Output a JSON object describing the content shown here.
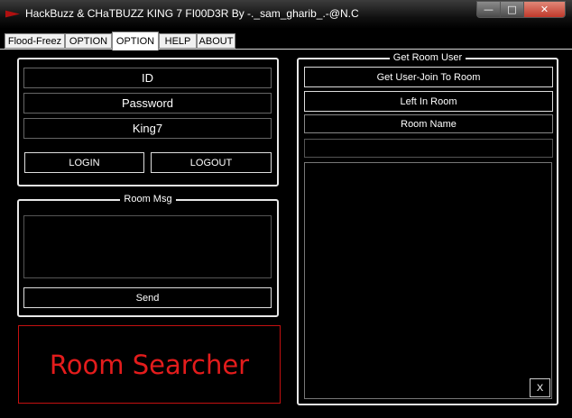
{
  "window": {
    "title": "HackBuzz & CHaTBUZZ KING 7 FI00D3R By -._sam_gharib_.-@N.C",
    "minimize": "—",
    "maximize": "□",
    "close": "✕"
  },
  "tabs": [
    {
      "label": "Flood-Freez",
      "active": false
    },
    {
      "label": "OPTION",
      "active": false
    },
    {
      "label": "OPTION",
      "active": true
    },
    {
      "label": "HELP",
      "active": false
    },
    {
      "label": "ABOUT",
      "active": false
    }
  ],
  "login": {
    "id_value": "ID",
    "password_value": "Password",
    "room_value": "King7",
    "login_label": "LOGIN",
    "logout_label": "LOGOUT"
  },
  "room_msg": {
    "legend": "Room Msg",
    "message_value": "",
    "send_label": "Send"
  },
  "room_searcher": {
    "label": "Room Searcher"
  },
  "get_room_user": {
    "legend": "Get Room User",
    "get_user_join_label": "Get User-Join To Room",
    "left_in_room_label": "Left In Room",
    "room_name_label": "Room Name",
    "room_name_value": "",
    "close_list_label": "X"
  },
  "colors": {
    "background": "#000000",
    "accent_red": "#e31c1c"
  }
}
